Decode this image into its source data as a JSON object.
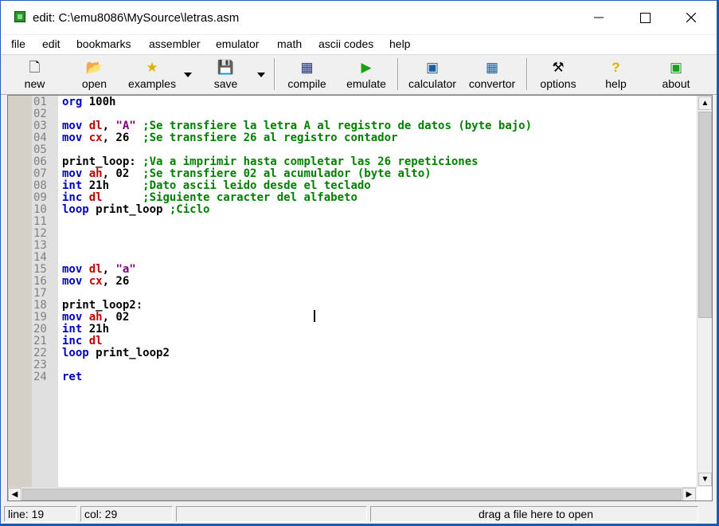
{
  "window": {
    "title": "edit: C:\\emu8086\\MySource\\letras.asm"
  },
  "menu": [
    "file",
    "edit",
    "bookmarks",
    "assembler",
    "emulator",
    "math",
    "ascii codes",
    "help"
  ],
  "toolbar": {
    "new": "new",
    "open": "open",
    "examples": "examples",
    "save": "save",
    "compile": "compile",
    "emulate": "emulate",
    "calculator": "calculator",
    "convertor": "convertor",
    "options": "options",
    "help": "help",
    "about": "about"
  },
  "editor": {
    "lines": [
      {
        "n": "01",
        "segs": [
          [
            "kw",
            "org "
          ],
          [
            "",
            "100h"
          ]
        ]
      },
      {
        "n": "02",
        "segs": []
      },
      {
        "n": "03",
        "segs": [
          [
            "kw",
            "mov "
          ],
          [
            "reg",
            "dl"
          ],
          [
            "",
            ", "
          ],
          [
            "str",
            "\"A\""
          ],
          [
            "cmt",
            " ;Se transfiere la letra A al registro de datos (byte bajo)"
          ]
        ]
      },
      {
        "n": "04",
        "segs": [
          [
            "kw",
            "mov "
          ],
          [
            "reg",
            "cx"
          ],
          [
            "",
            ", 26  "
          ],
          [
            "cmt",
            ";Se transfiere 26 al registro contador"
          ]
        ]
      },
      {
        "n": "05",
        "segs": []
      },
      {
        "n": "06",
        "segs": [
          [
            "",
            "print_loop: "
          ],
          [
            "cmt",
            ";Va a imprimir hasta completar las 26 repeticiones"
          ]
        ]
      },
      {
        "n": "07",
        "segs": [
          [
            "kw",
            "mov "
          ],
          [
            "reg",
            "ah"
          ],
          [
            "",
            ", 02  "
          ],
          [
            "cmt",
            ";Se transfiere 02 al acumulador (byte alto)"
          ]
        ]
      },
      {
        "n": "08",
        "segs": [
          [
            "kw",
            "int "
          ],
          [
            "",
            "21h     "
          ],
          [
            "cmt",
            ";Dato ascii leido desde el teclado"
          ]
        ]
      },
      {
        "n": "09",
        "segs": [
          [
            "kw",
            "inc "
          ],
          [
            "reg",
            "dl"
          ],
          [
            "",
            "      "
          ],
          [
            "cmt",
            ";Siguiente caracter del alfabeto"
          ]
        ]
      },
      {
        "n": "10",
        "segs": [
          [
            "kw",
            "loop "
          ],
          [
            "",
            "print_loop "
          ],
          [
            "cmt",
            ";Ciclo"
          ]
        ]
      },
      {
        "n": "11",
        "segs": []
      },
      {
        "n": "12",
        "segs": []
      },
      {
        "n": "13",
        "segs": []
      },
      {
        "n": "14",
        "segs": []
      },
      {
        "n": "15",
        "segs": [
          [
            "kw",
            "mov "
          ],
          [
            "reg",
            "dl"
          ],
          [
            "",
            ", "
          ],
          [
            "str",
            "\"a\""
          ]
        ]
      },
      {
        "n": "16",
        "segs": [
          [
            "kw",
            "mov "
          ],
          [
            "reg",
            "cx"
          ],
          [
            "",
            ", 26"
          ]
        ]
      },
      {
        "n": "17",
        "segs": []
      },
      {
        "n": "18",
        "segs": [
          [
            "",
            "print_loop2:"
          ]
        ]
      },
      {
        "n": "19",
        "segs": [
          [
            "kw",
            "mov "
          ],
          [
            "reg",
            "ah"
          ],
          [
            "",
            ", 02"
          ]
        ]
      },
      {
        "n": "20",
        "segs": [
          [
            "kw",
            "int "
          ],
          [
            "",
            "21h"
          ]
        ]
      },
      {
        "n": "21",
        "segs": [
          [
            "kw",
            "inc "
          ],
          [
            "reg",
            "dl"
          ]
        ]
      },
      {
        "n": "22",
        "segs": [
          [
            "kw",
            "loop "
          ],
          [
            "",
            "print_loop2"
          ]
        ]
      },
      {
        "n": "23",
        "segs": []
      },
      {
        "n": "24",
        "segs": [
          [
            "kw",
            "ret"
          ]
        ]
      }
    ]
  },
  "status": {
    "line": "line: 19",
    "col": "col: 29",
    "drop": "drag a file here to open"
  }
}
